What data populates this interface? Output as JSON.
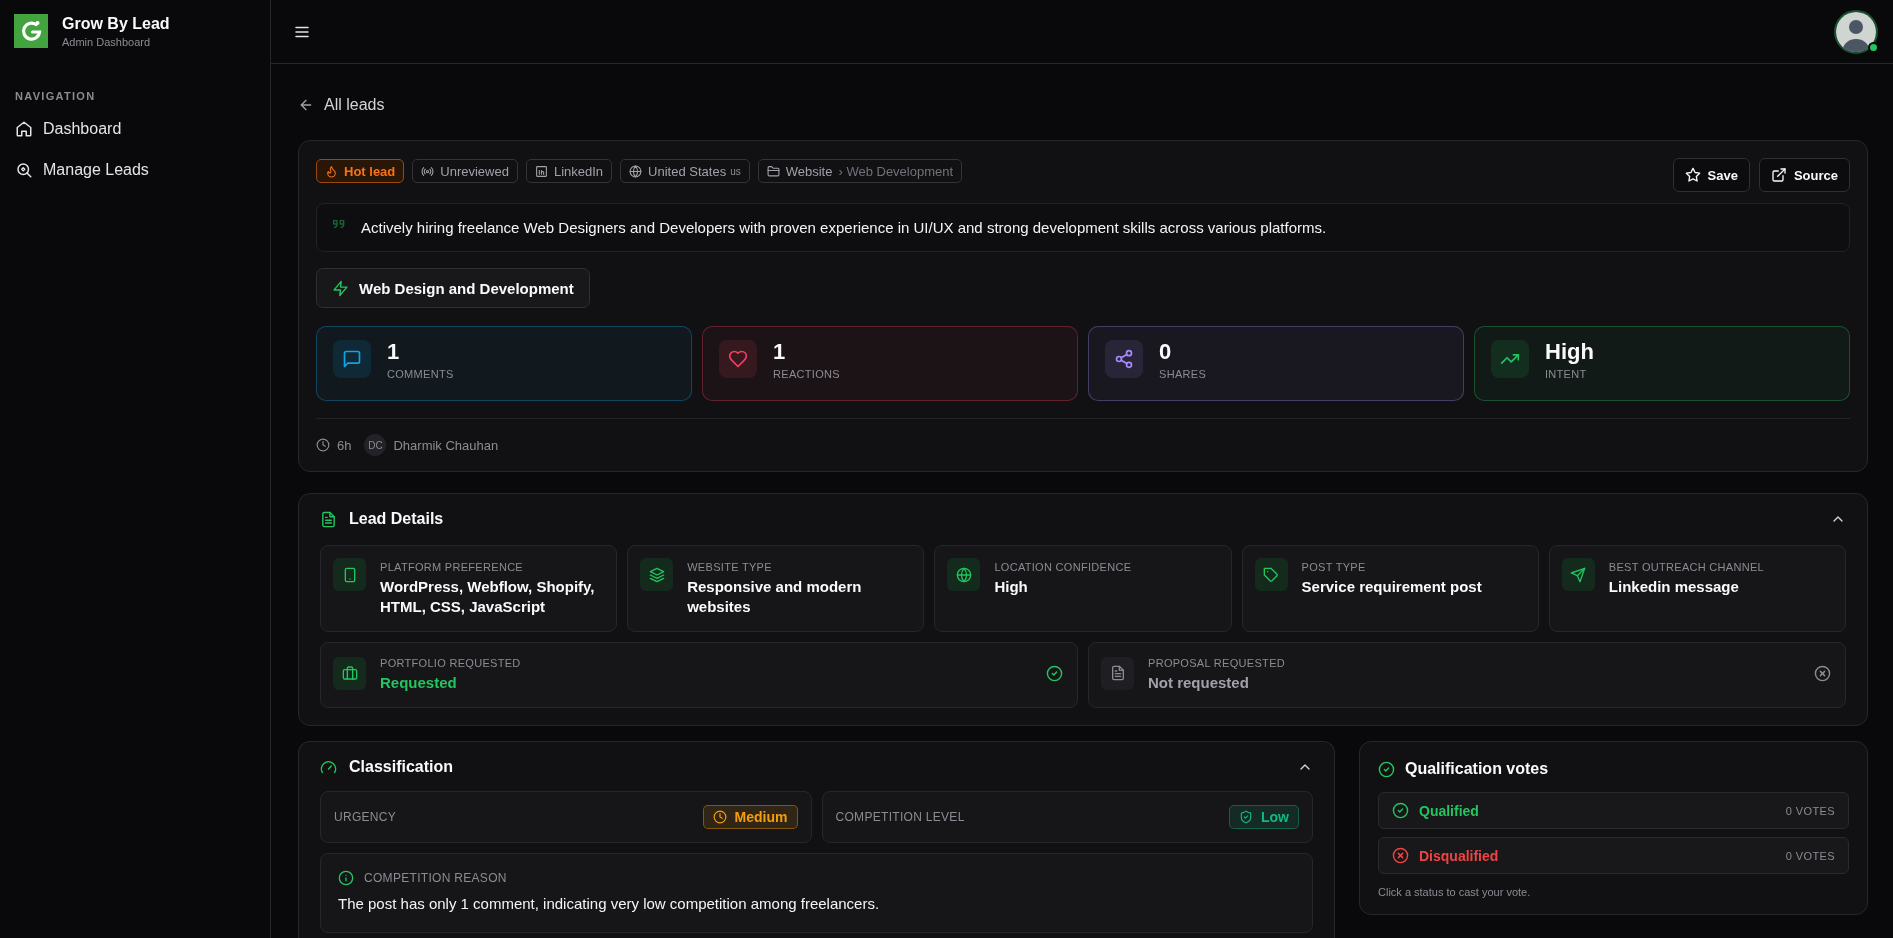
{
  "brand": {
    "name": "Grow By Lead",
    "subtitle": "Admin Dashboard"
  },
  "sidebar": {
    "heading": "NAVIGATION",
    "items": [
      {
        "kind": "home",
        "label": "Dashboard",
        "selected": false
      },
      {
        "kind": "search",
        "label": "Manage Leads",
        "selected": false
      }
    ]
  },
  "user": {
    "online": true
  },
  "back_link": "All leads",
  "lead": {
    "tags": [
      {
        "kind": "hot",
        "label": "Hot lead"
      },
      {
        "kind": "status",
        "label": "Unreviewed"
      },
      {
        "kind": "platform",
        "label": "LinkedIn"
      },
      {
        "kind": "location",
        "label": "United States",
        "code": "us"
      },
      {
        "kind": "category",
        "label": "Website",
        "separator": "›",
        "sub": "Web Development"
      }
    ],
    "actions": [
      {
        "kind": "save",
        "label": "Save"
      },
      {
        "kind": "source",
        "label": "Source"
      }
    ],
    "quote": "Actively hiring freelance Web Designers and Developers with proven experience in UI/UX and strong development skills across various platforms.",
    "category": "Web Design and Development",
    "stats": [
      {
        "kind": "comments",
        "value": "1",
        "label": "COMMENTS",
        "color": "#0ea5e9"
      },
      {
        "kind": "reactions",
        "value": "1",
        "label": "REACTIONS",
        "color": "#f43f5e"
      },
      {
        "kind": "shares",
        "value": "0",
        "label": "SHARES",
        "color": "#a78bfa"
      },
      {
        "kind": "intent",
        "value": "High",
        "label": "INTENT",
        "color": "#22c55e"
      }
    ],
    "time": "6h",
    "author_initials": "DC",
    "author": "Dharmik Chauhan"
  },
  "lead_details": {
    "title": "Lead Details",
    "expanded": true,
    "items": [
      {
        "kind": "platform",
        "label": "PLATFORM PREFERENCE",
        "value": "WordPress, Webflow, Shopify, HTML, CSS, JavaScript"
      },
      {
        "kind": "website",
        "label": "WEBSITE TYPE",
        "value": "Responsive and modern websites"
      },
      {
        "kind": "location",
        "label": "LOCATION CONFIDENCE",
        "value": "High"
      },
      {
        "kind": "post",
        "label": "POST TYPE",
        "value": "Service requirement post"
      },
      {
        "kind": "outreach",
        "label": "BEST OUTREACH CHANNEL",
        "value": "Linkedin message"
      }
    ],
    "requests": [
      {
        "kind": "portfolio",
        "label": "PORTFOLIO REQUESTED",
        "value": "Requested",
        "requested": true
      },
      {
        "kind": "proposal",
        "label": "PROPOSAL REQUESTED",
        "value": "Not requested",
        "requested": false
      }
    ]
  },
  "classification": {
    "title": "Classification",
    "expanded": true,
    "ratings": [
      {
        "kind": "urgency",
        "label": "URGENCY",
        "value": "Medium",
        "color": "#f59e0b"
      },
      {
        "kind": "competition",
        "label": "COMPETITION LEVEL",
        "value": "Low",
        "color": "#10b981"
      }
    ],
    "reason": {
      "label": "COMPETITION REASON",
      "text": "The post has only 1 comment, indicating very low competition among freelancers."
    }
  },
  "votes": {
    "title": "Qualification votes",
    "options": [
      {
        "kind": "qualified",
        "label": "Qualified",
        "count": "0 VOTES"
      },
      {
        "kind": "disqualified",
        "label": "Disqualified",
        "count": "0 VOTES"
      }
    ],
    "hint": "Click a status to cast your vote."
  }
}
